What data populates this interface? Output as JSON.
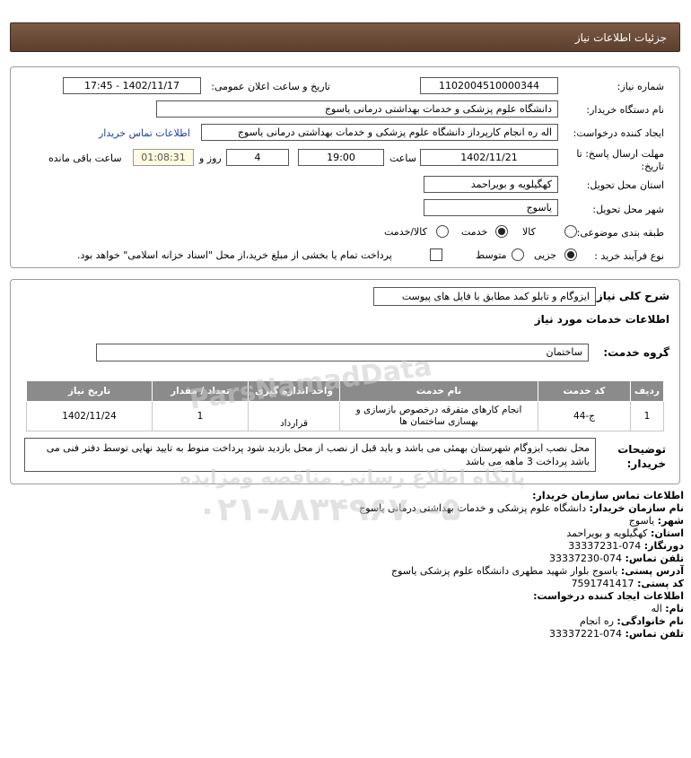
{
  "header": {
    "title": "جزئیات اطلاعات نیاز"
  },
  "form": {
    "need_number_label": "شماره نیاز:",
    "need_number": "1102004510000344",
    "announce_label": "تاریخ و ساعت اعلان عمومی:",
    "announce_value": "1402/11/17 - 17:45",
    "buyer_org_label": "نام دستگاه خریدار:",
    "buyer_org": "دانشگاه علوم پزشکی و خدمات بهداشتی  درمانی یاسوج",
    "creator_label": "ایجاد کننده درخواست:",
    "creator": "اله ره انجام کارپرداز دانشگاه علوم پزشکی و خدمات بهداشتی  درمانی یاسوج",
    "buyer_contact_link": "اطلاعات تماس خریدار",
    "deadline_label_1": "مهلت ارسال پاسخ: تا",
    "deadline_label_2": "تاریخ:",
    "deadline_date": "1402/11/21",
    "time_label": "ساعت",
    "deadline_time": "19:00",
    "days_value": "4",
    "days_label": "روز و",
    "remaining_time": "01:08:31",
    "remaining_label": "ساعت باقی مانده",
    "province_label": "استان محل تحویل:",
    "province": "کهگیلویه و بویراحمد",
    "city_label": "شهر محل تحویل:",
    "city": "یاسوج",
    "category_label": "طبقه بندی موضوعی:",
    "category_options": [
      "کالا",
      "خدمت",
      "کالا/خدمت"
    ],
    "process_label": "نوع فرآیند خرید :",
    "process_options": [
      "جزیی",
      "متوسط"
    ],
    "treasury_text": "پرداخت تمام یا بخشی از مبلغ خرید،از محل \"اسناد خزانه اسلامی\" خواهد بود."
  },
  "summary": {
    "general_desc_label": "شرح کلی نیاز:",
    "general_desc": "ایزوگام و تابلو کمد مطابق با فایل های پیوست",
    "services_title": "اطلاعات خدمات مورد نیاز",
    "service_group_label": "گروه خدمت:",
    "service_group": "ساختمان",
    "table": {
      "headers": [
        "ردیف",
        "کد خدمت",
        "نام خدمت",
        "واحد اندازه گیری",
        "تعداد / مقدار",
        "تاریخ نیاز"
      ],
      "rows": [
        [
          "1",
          "ج-44",
          "انجام کارهای متفرقه درخصوص بازسازی و بهسازی ساختمان ها",
          "قرارداد",
          "1",
          "1402/11/24"
        ]
      ]
    },
    "buyer_notes_label_1": "توضیحات",
    "buyer_notes_label_2": "خریدار:",
    "buyer_notes": "محل نصب ایزوگام شهرستان بهمئی می باشد و باید قبل از نصب از محل بازدید شود پرداخت منوط به تایید نهایی توسط دفتر فنی می باشد پرداخت 3 ماهه می باشد"
  },
  "contact": {
    "title": "اطلاعات تماس سازمان خریدار:",
    "org_label": "نام سازمان خریدار:",
    "org": "دانشگاه علوم پزشکی و خدمات بهداشتی درمانی یاسوج",
    "city_label": "شهر:",
    "city": "یاسوج",
    "province_label": "استان:",
    "province": "کهگیلویه و بویراحمد",
    "fax_label": "دورنگار:",
    "fax": "074-33337231",
    "phone_label": "تلفن تماس:",
    "phone": "074-33337230",
    "address_label": "آدرس پستی:",
    "address": "یاسوج بلوار شهید مطهری دانشگاه علوم پزشکی یاسوج",
    "postal_label": "کد پستی:",
    "postal": "7591741417",
    "creator_title": "اطلاعات ایجاد کننده درخواست:",
    "name_label": "نام:",
    "name": "اله",
    "family_label": "نام خانوادگی:",
    "family": "ره انجام",
    "creator_phone_label": "تلفن تماس:",
    "creator_phone": "074-33337221"
  },
  "watermark": {
    "brand": "ParsNamadData",
    "line1": "پایگاه اطلاع رسانی مناقصه ومزایده",
    "phone": "۰۲۱-۸۸۳۴۹۶۷۰-۵"
  }
}
